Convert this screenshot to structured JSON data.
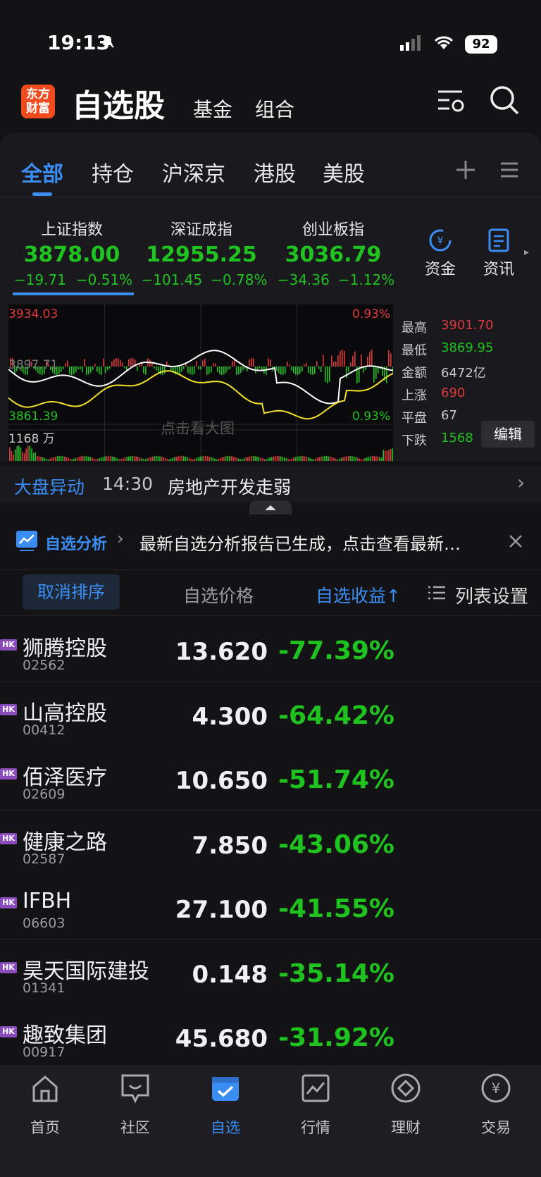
{
  "status_bar": {
    "time": "19:13",
    "battery": "92"
  },
  "header": {
    "logo_text": "东方财富",
    "title": "自选股",
    "tabs": [
      "基金",
      "组合"
    ]
  },
  "filter_tabs": [
    "全部",
    "持仓",
    "沪深京",
    "港股",
    "美股"
  ],
  "indices": [
    {
      "name": "上证指数",
      "value": "3878.00",
      "change": "−19.71",
      "pct": "−0.51%"
    },
    {
      "name": "深证成指",
      "value": "12955.25",
      "change": "−101.45",
      "pct": "−0.78%"
    },
    {
      "name": "创业板指",
      "value": "3036.79",
      "change": "−34.36",
      "pct": "−1.12%"
    }
  ],
  "side_buttons": {
    "funds": "资金",
    "news": "资讯"
  },
  "chart": {
    "high_label": "3934.03",
    "low_label": "3861.39",
    "mid_label": "3897.71",
    "pct_top": "0.93%",
    "pct_bottom": "0.93%",
    "volume_label": "1168 万",
    "overlay": "点击看大图",
    "colors": {
      "price": "#ffffff",
      "avg": "#f2e12c",
      "up": "#e0393a",
      "down": "#1fc21f"
    }
  },
  "market_stats": {
    "high": {
      "label": "最高",
      "value": "3901.70"
    },
    "low": {
      "label": "最低",
      "value": "3869.95"
    },
    "amount": {
      "label": "金额",
      "value": "6472亿"
    },
    "rise": {
      "label": "上涨",
      "value": "690"
    },
    "flat": {
      "label": "平盘",
      "value": "67"
    },
    "fall": {
      "label": "下跌",
      "value": "1568"
    },
    "edit": "编辑"
  },
  "anomaly": {
    "label": "大盘异动",
    "time": "14:30",
    "text": "房地产开发走弱"
  },
  "analysis": {
    "label": "自选分析",
    "text": "最新自选分析报告已生成，点击查看最新…"
  },
  "sort_bar": {
    "cancel": "取消排序",
    "price_col": "自选价格",
    "return_col": "自选收益↑",
    "settings": "列表设置"
  },
  "stocks": [
    {
      "market": "HK",
      "name": "狮腾控股",
      "code": "02562",
      "price": "13.620",
      "pct": "-77.39%"
    },
    {
      "market": "HK",
      "name": "山高控股",
      "code": "00412",
      "price": "4.300",
      "pct": "-64.42%"
    },
    {
      "market": "HK",
      "name": "佰泽医疗",
      "code": "02609",
      "price": "10.650",
      "pct": "-51.74%"
    },
    {
      "market": "HK",
      "name": "健康之路",
      "code": "02587",
      "price": "7.850",
      "pct": "-43.06%"
    },
    {
      "market": "HK",
      "name": "IFBH",
      "code": "06603",
      "price": "27.100",
      "pct": "-41.55%"
    },
    {
      "market": "HK",
      "name": "昊天国际建投",
      "code": "01341",
      "price": "0.148",
      "pct": "-35.14%"
    },
    {
      "market": "HK",
      "name": "趣致集团",
      "code": "00917",
      "price": "45.680",
      "pct": "-31.92%"
    }
  ],
  "bottom_nav": [
    "首页",
    "社区",
    "自选",
    "行情",
    "理财",
    "交易"
  ]
}
